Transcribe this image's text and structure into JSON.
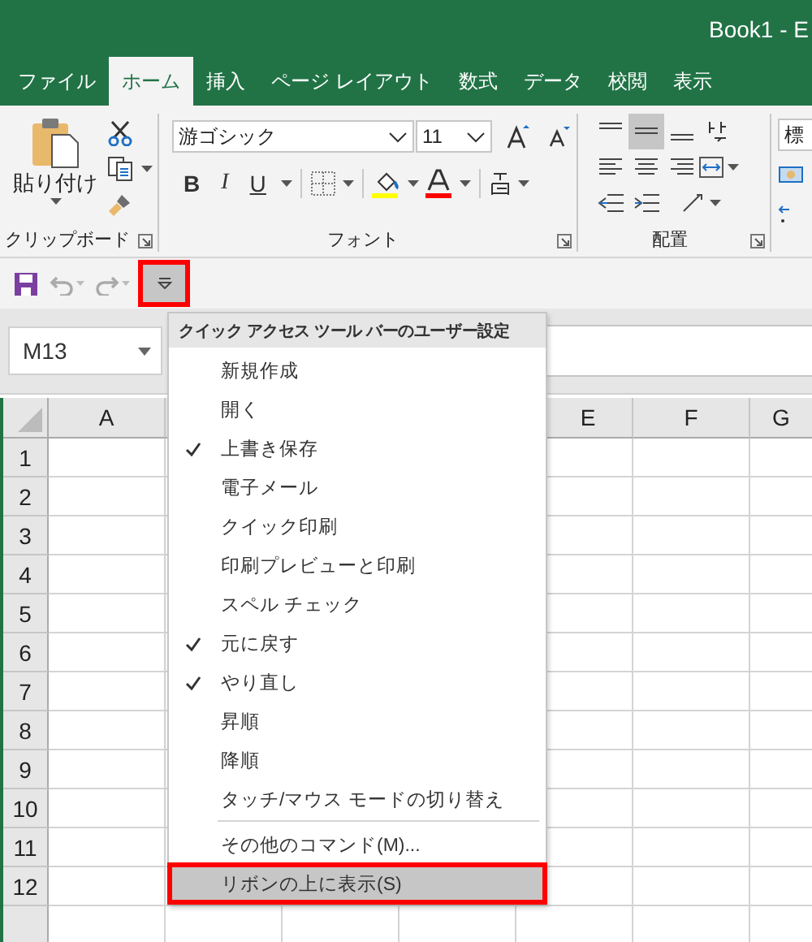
{
  "window": {
    "title": "Book1 - E"
  },
  "tabs": [
    {
      "label": "ファイル",
      "selected": false
    },
    {
      "label": "ホーム",
      "selected": true
    },
    {
      "label": "挿入",
      "selected": false
    },
    {
      "label": "ページ レイアウト",
      "selected": false
    },
    {
      "label": "数式",
      "selected": false
    },
    {
      "label": "データ",
      "selected": false
    },
    {
      "label": "校閲",
      "selected": false
    },
    {
      "label": "表示",
      "selected": false
    }
  ],
  "ribbon": {
    "clipboard": {
      "paste_label": "貼り付け",
      "group_label": "クリップボード"
    },
    "font": {
      "font_name": "游ゴシック",
      "font_size": "11",
      "bold": "B",
      "italic": "I",
      "underline": "U",
      "group_label": "フォント"
    },
    "alignment": {
      "group_label": "配置"
    },
    "number": {
      "format": "標"
    }
  },
  "quick_access": {
    "customize_button": {
      "selected": true,
      "highlighted": true
    }
  },
  "name_box": {
    "value": "M13"
  },
  "sheet": {
    "columns": [
      "A",
      "E",
      "F",
      "G"
    ],
    "rows": [
      "1",
      "2",
      "3",
      "4",
      "5",
      "6",
      "7",
      "8",
      "9",
      "10",
      "11",
      "12"
    ]
  },
  "qat_menu": {
    "title": "クイック アクセス ツール バーのユーザー設定",
    "commands": [
      {
        "label": "新規作成",
        "checked": false
      },
      {
        "label": "開く",
        "checked": false
      },
      {
        "label": "上書き保存",
        "checked": true
      },
      {
        "label": "電子メール",
        "checked": false
      },
      {
        "label": "クイック印刷",
        "checked": false
      },
      {
        "label": "印刷プレビューと印刷",
        "checked": false
      },
      {
        "label": "スペル チェック",
        "checked": false
      },
      {
        "label": "元に戻す",
        "checked": true
      },
      {
        "label": "やり直し",
        "checked": true
      },
      {
        "label": "昇順",
        "checked": false
      },
      {
        "label": "降順",
        "checked": false
      },
      {
        "label": "タッチ/マウス モードの切り替え",
        "checked": false
      }
    ],
    "other_items": [
      {
        "label": "その他のコマンド(M)...",
        "selected": false,
        "highlighted": false
      },
      {
        "label": "リボンの上に表示(S)",
        "selected": true,
        "highlighted": true
      }
    ]
  }
}
